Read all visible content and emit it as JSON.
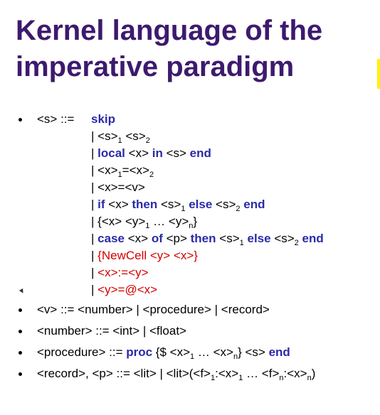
{
  "slide": {
    "title_line1": "Kernel language of the",
    "title_line2": "imperative paradigm",
    "s_def": {
      "lhs": "<s> ::=",
      "skip": "skip",
      "pipe": "|",
      "s": "<s>",
      "x": "<x>",
      "y": "<y>",
      "v": "<v>",
      "p": "<p>",
      "sub1": "1",
      "sub2": "2",
      "subn": "n",
      "local": "local",
      "in": "in",
      "end": "end",
      "if": "if",
      "then": "then",
      "else": "else",
      "case": "case",
      "of": "of",
      "eq": "=",
      "ellipsis": "…",
      "lbrace": "{",
      "rbrace": "}",
      "newcell": "{NewCell <y> <x>}",
      "assign": "<x>:=<y>",
      "exchange": "<y>=@<x>"
    },
    "v_def": "<v> ::= <number> | <procedure> | <record>",
    "number_def": "<number> ::= <int> | <float>",
    "procedure_def": {
      "lhs": "<procedure> ::= ",
      "proc": "proc",
      "body": " {$ <x>",
      "mid": " … <x>",
      "tail": "} <s> ",
      "end": "end"
    },
    "record_def": {
      "head": "<record>, <p> ::= <lit> | <lit>(<f>",
      "a": ":<x>",
      "b": " … <f>",
      "c": ":<x>",
      "close": ")"
    }
  }
}
